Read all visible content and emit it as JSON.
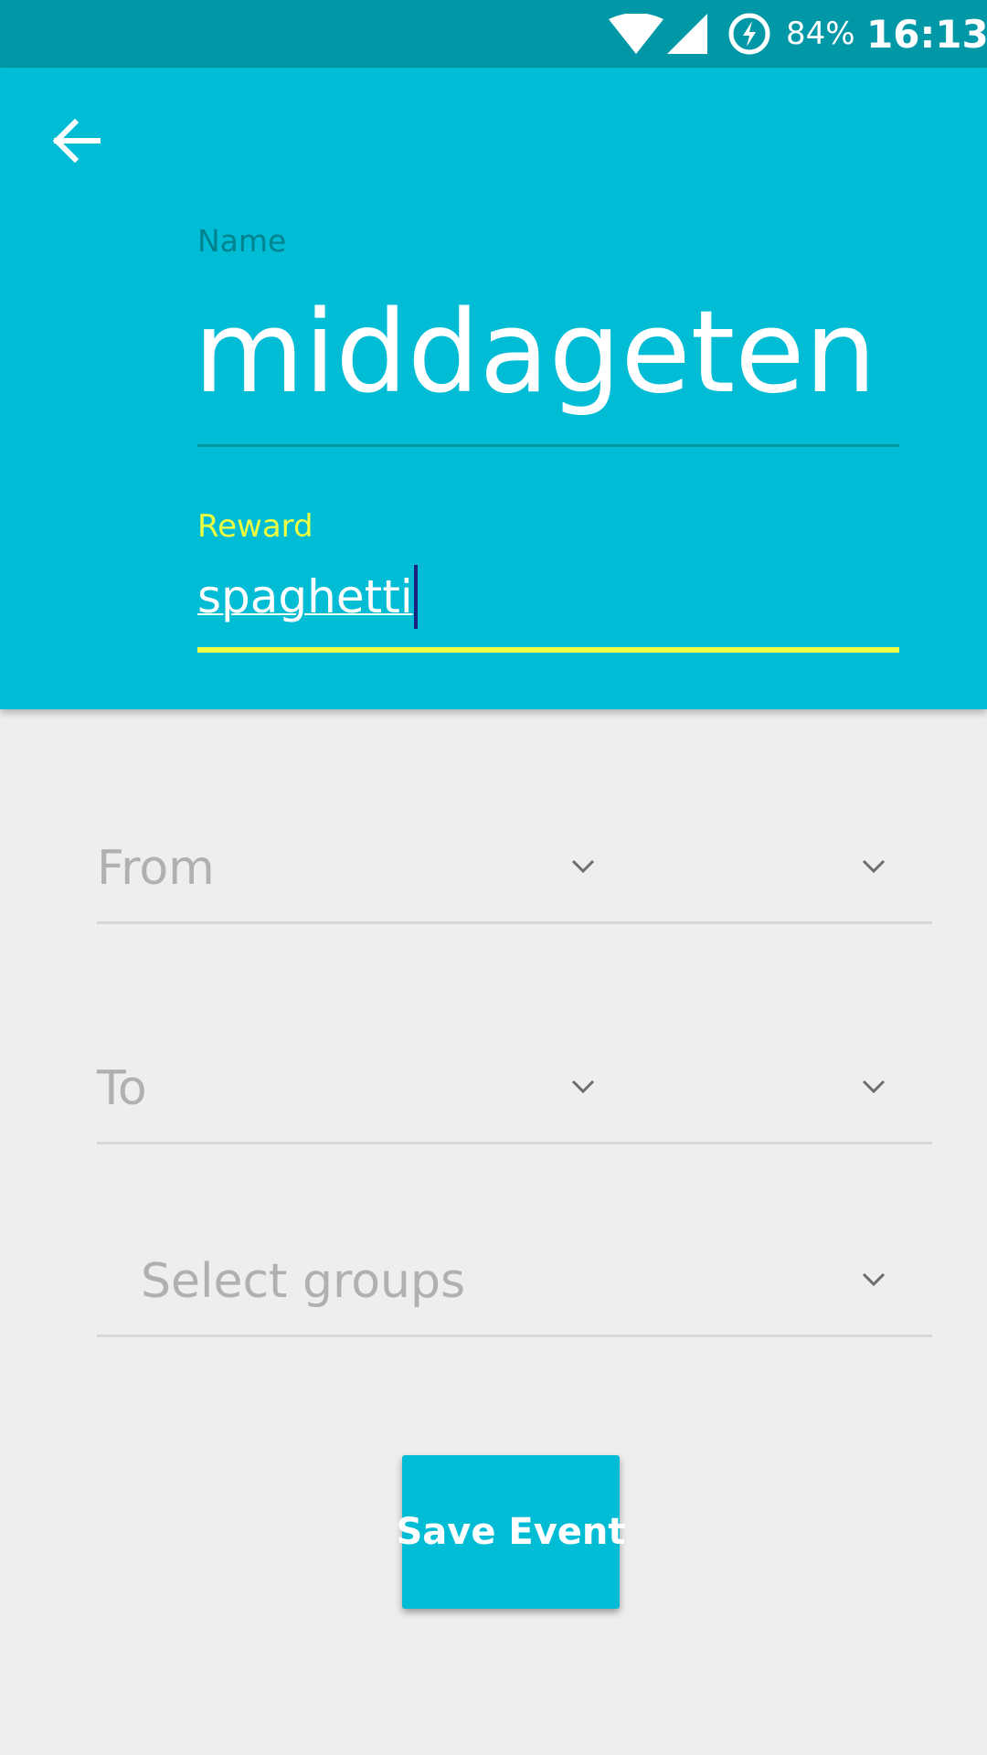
{
  "status_bar": {
    "battery_percent": "84%",
    "time": "16:13",
    "icons": [
      "wifi-icon",
      "cell-signal-icon",
      "battery-saver-icon"
    ]
  },
  "header": {
    "back_icon": "arrow-back-icon",
    "name_label": "Name",
    "name_value": "middageten",
    "reward_label": "Reward",
    "reward_value": "spaghetti"
  },
  "form": {
    "from_label": "From",
    "to_label": "To",
    "groups_placeholder": "Select groups"
  },
  "actions": {
    "save_label": "Save Event"
  },
  "colors": {
    "primary": "#00bcd4",
    "primary_dark": "#0097a7",
    "accent": "#eeff41",
    "background": "#eeeeee"
  }
}
